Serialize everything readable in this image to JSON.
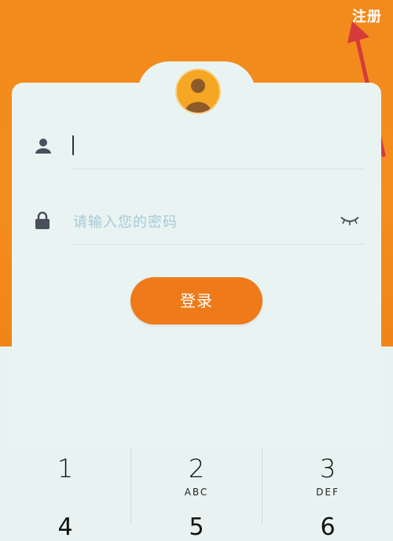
{
  "header": {
    "register_label": "注册"
  },
  "login": {
    "username_value": "",
    "password_placeholder": "请输入您的密码",
    "submit_label": "登录"
  },
  "keyboard": {
    "keys": [
      {
        "num": "1",
        "letters": ""
      },
      {
        "num": "2",
        "letters": "ABC"
      },
      {
        "num": "3",
        "letters": "DEF"
      },
      {
        "num": "4",
        "letters": ""
      },
      {
        "num": "5",
        "letters": ""
      },
      {
        "num": "6",
        "letters": ""
      }
    ]
  },
  "colors": {
    "brand": "#f28a1c",
    "button": "#ee7a1a",
    "annotation_arrow": "#d63a3a"
  },
  "icons": [
    "user-icon",
    "lock-icon",
    "eye-closed-icon",
    "avatar-icon",
    "arrow-annotation"
  ]
}
